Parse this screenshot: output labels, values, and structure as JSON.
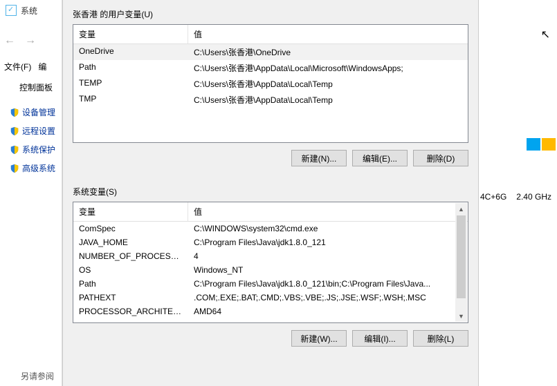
{
  "bg": {
    "title": "系统",
    "menu_file": "文件(F)",
    "menu_edit": "编",
    "cpl": "控制面板",
    "links": [
      "设备管理",
      "远程设置",
      "系统保护",
      "高级系统"
    ],
    "footnote": "另请参阅",
    "spec1": "4C+6G",
    "spec2": "2.40 GHz"
  },
  "dialog": {
    "user_section": "张香港 的用户变量(U)",
    "sys_section": "系统变量(S)",
    "col_name": "变量",
    "col_value": "值",
    "user_vars": [
      {
        "name": "OneDrive",
        "value": "C:\\Users\\张香港\\OneDrive",
        "sel": true
      },
      {
        "name": "Path",
        "value": "C:\\Users\\张香港\\AppData\\Local\\Microsoft\\WindowsApps;"
      },
      {
        "name": "TEMP",
        "value": "C:\\Users\\张香港\\AppData\\Local\\Temp"
      },
      {
        "name": "TMP",
        "value": "C:\\Users\\张香港\\AppData\\Local\\Temp"
      }
    ],
    "sys_vars": [
      {
        "name": "ComSpec",
        "value": "C:\\WINDOWS\\system32\\cmd.exe"
      },
      {
        "name": "JAVA_HOME",
        "value": "C:\\Program Files\\Java\\jdk1.8.0_121"
      },
      {
        "name": "NUMBER_OF_PROCESSORS",
        "value": "4"
      },
      {
        "name": "OS",
        "value": "Windows_NT"
      },
      {
        "name": "Path",
        "value": "C:\\Program Files\\Java\\jdk1.8.0_121\\bin;C:\\Program Files\\Java..."
      },
      {
        "name": "PATHEXT",
        "value": ".COM;.EXE;.BAT;.CMD;.VBS;.VBE;.JS;.JSE;.WSF;.WSH;.MSC"
      },
      {
        "name": "PROCESSOR_ARCHITECT...",
        "value": "AMD64"
      }
    ],
    "btn_new_u": "新建(N)...",
    "btn_edit_u": "编辑(E)...",
    "btn_del_u": "删除(D)",
    "btn_new_s": "新建(W)...",
    "btn_edit_s": "编辑(I)...",
    "btn_del_s": "删除(L)"
  }
}
